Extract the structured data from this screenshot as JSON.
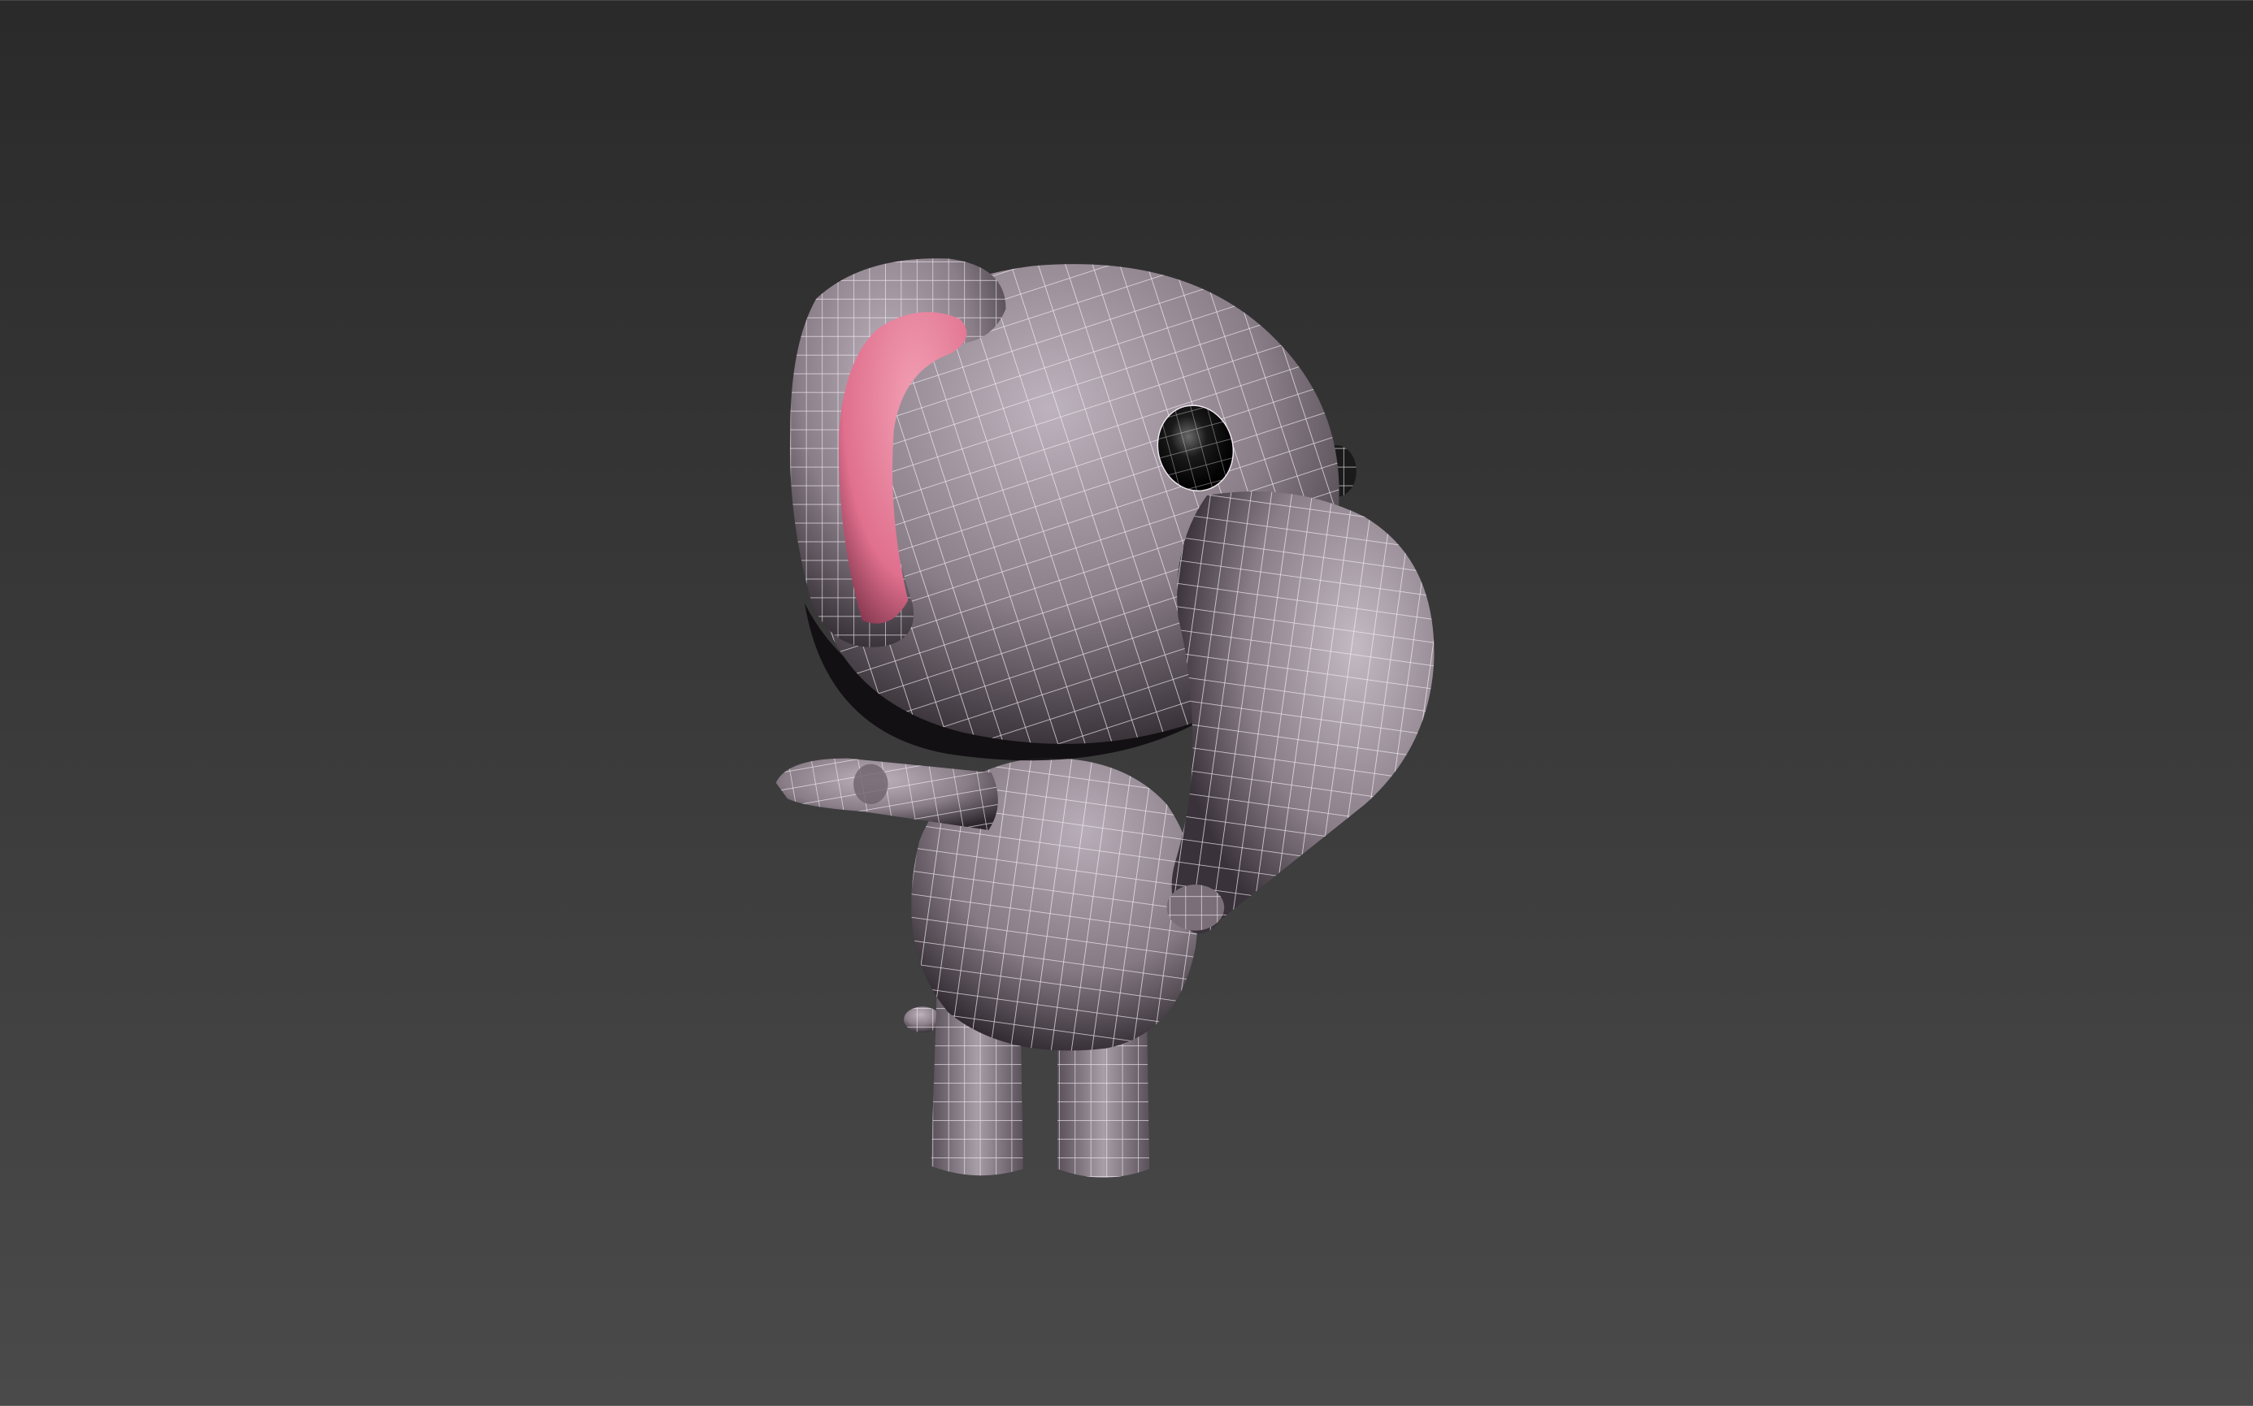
{
  "viewport": {
    "background_top": "#2a2a2a",
    "background_bottom": "#4a4a4a",
    "shading_mode": "shaded-with-wireframe"
  },
  "model": {
    "subject": "cartoon-elephant",
    "body_color": "#8a7e88",
    "body_highlight": "#b8adb8",
    "body_shadow": "#2e282e",
    "ear_inner_color": "#e0708e",
    "eye_color": "#111111",
    "wire_color": "#f4eef4"
  }
}
